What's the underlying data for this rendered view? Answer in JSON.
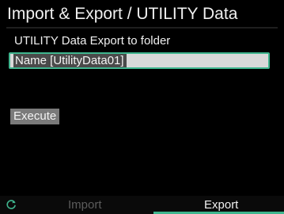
{
  "header": {
    "title": "Import & Export / UTILITY Data"
  },
  "main": {
    "subtitle": "UTILITY Data Export to folder",
    "name_field": {
      "value": "Name [UtilityData01]"
    },
    "execute_label": "Execute"
  },
  "bottom_bar": {
    "refresh_icon": "refresh-icon",
    "tabs": [
      {
        "label": "Import",
        "active": false
      },
      {
        "label": "Export",
        "active": true
      }
    ]
  },
  "colors": {
    "background": "#000000",
    "accent": "#3fb58e",
    "button": "#7a7a7a",
    "inactive_tab": "#5c5c5c"
  }
}
